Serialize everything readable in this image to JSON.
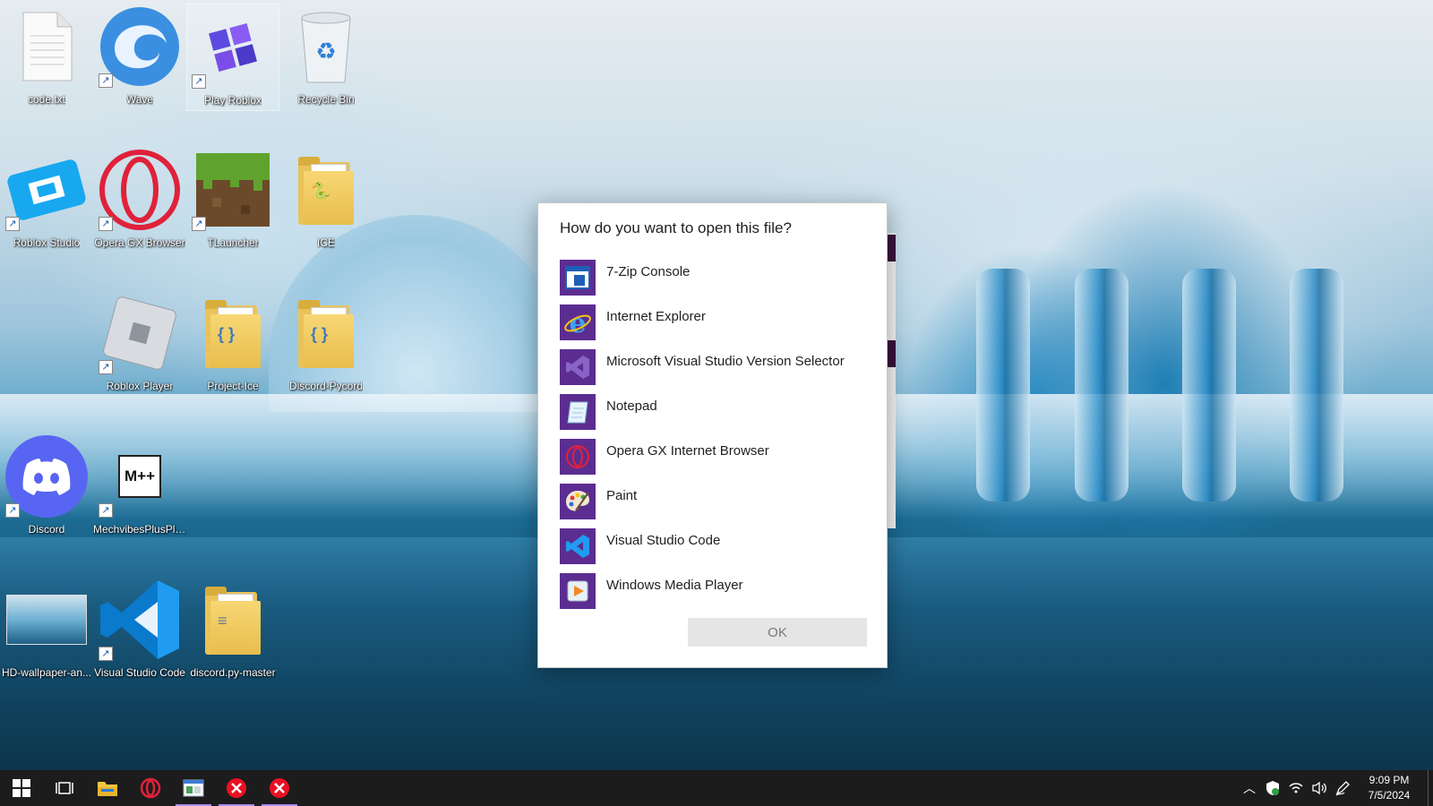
{
  "desktop": {
    "icons": [
      {
        "label": "code.txt",
        "icon": "text-file-icon",
        "shortcut": false
      },
      {
        "label": "Wave",
        "icon": "wave-icon",
        "shortcut": true
      },
      {
        "label": "Play Roblox",
        "icon": "play-roblox-icon",
        "shortcut": true
      },
      {
        "label": "Recycle Bin",
        "icon": "recycle-bin-icon",
        "shortcut": false
      },
      {
        "label": "Roblox Studio",
        "icon": "roblox-studio-icon",
        "shortcut": true
      },
      {
        "label": "Opera GX Browser",
        "icon": "opera-gx-icon",
        "shortcut": true
      },
      {
        "label": "TLauncher",
        "icon": "minecraft-grass-icon",
        "shortcut": true
      },
      {
        "label": "ICE",
        "icon": "python-folder-icon",
        "shortcut": false
      },
      {
        "label": "Roblox Player",
        "icon": "roblox-player-icon",
        "shortcut": true
      },
      {
        "label": "Project-Ice",
        "icon": "code-folder-icon",
        "shortcut": false
      },
      {
        "label": "Discord-Pycord",
        "icon": "code-folder-icon",
        "shortcut": false
      },
      {
        "label": "Discord",
        "icon": "discord-icon",
        "shortcut": true
      },
      {
        "label": "MechvibesPlusPlus",
        "icon": "mechvibes-icon",
        "shortcut": true
      },
      {
        "label": "HD-wallpaper-an...",
        "icon": "image-thumbnail-icon",
        "shortcut": false
      },
      {
        "label": "Visual Studio Code",
        "icon": "vscode-icon",
        "shortcut": true
      },
      {
        "label": "discord.py-master",
        "icon": "folder-icon",
        "shortcut": false
      }
    ],
    "folder_glyphs": {
      "python": "🐍",
      "code": "{ }",
      "docs": "≡"
    },
    "mechvibes_text": "M++"
  },
  "dialog": {
    "title": "How do you want to open this file?",
    "apps": [
      {
        "name": "7-Zip Console",
        "icon": "console-window-icon"
      },
      {
        "name": "Internet Explorer",
        "icon": "internet-explorer-icon"
      },
      {
        "name": "Microsoft Visual Studio Version Selector",
        "icon": "visual-studio-icon"
      },
      {
        "name": "Notepad",
        "icon": "notepad-icon"
      },
      {
        "name": "Opera GX Internet Browser",
        "icon": "opera-gx-icon"
      },
      {
        "name": "Paint",
        "icon": "paint-palette-icon"
      },
      {
        "name": "Visual Studio Code",
        "icon": "vscode-icon"
      },
      {
        "name": "Windows Media Player",
        "icon": "media-player-icon"
      }
    ],
    "ok_label": "OK",
    "tile_color": "#5c2d91"
  },
  "taskbar": {
    "buttons": [
      "windows-start-icon",
      "task-view-icon",
      "file-explorer-icon",
      "opera-gx-icon",
      "window-app-icon",
      "error-app-icon",
      "error-app-icon"
    ],
    "tray": [
      "chevron-up-icon",
      "security-shield-icon",
      "wifi-icon",
      "volume-icon",
      "pen-icon"
    ],
    "time": "9:09 PM",
    "date": "7/5/2024"
  }
}
